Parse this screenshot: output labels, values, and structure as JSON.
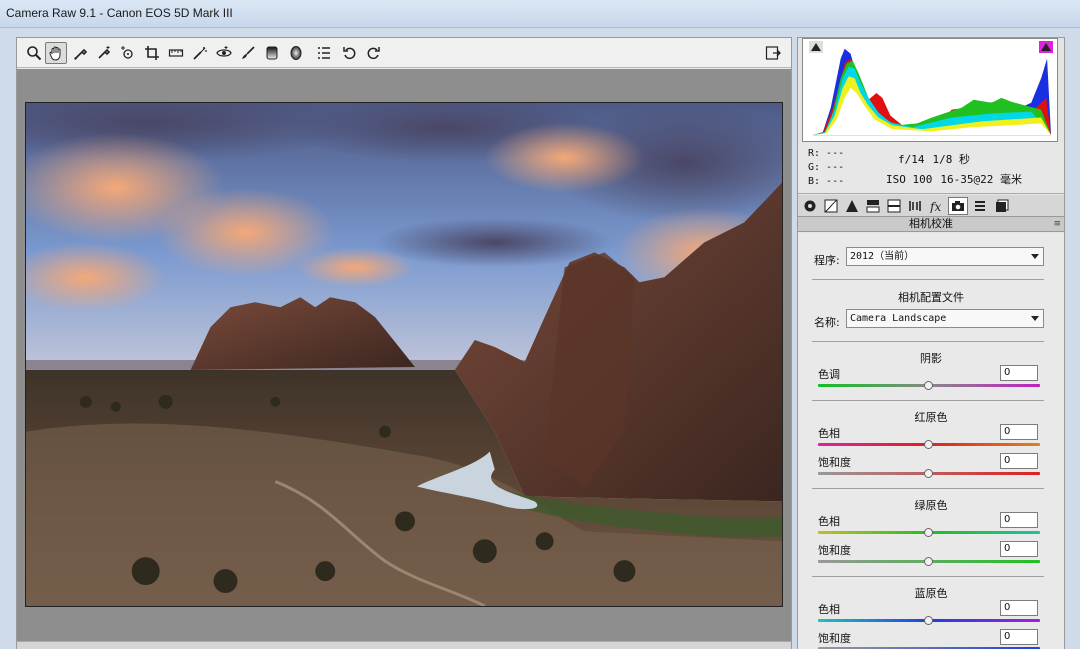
{
  "window": {
    "title": "Camera Raw 9.1  -  Canon EOS 5D Mark III"
  },
  "toolbar": {
    "tools": [
      "zoom-icon",
      "hand-icon",
      "white-balance-icon",
      "color-sampler-icon",
      "targeted-adjustment-icon",
      "crop-icon",
      "straighten-icon",
      "spot-removal-icon",
      "red-eye-icon",
      "adjustment-brush-icon",
      "graduated-filter-icon",
      "radial-filter-icon",
      "preferences-icon",
      "rotate-ccw-icon",
      "rotate-cw-icon"
    ],
    "active_tool": "hand-icon",
    "fullscreen": "toggle-fullscreen-icon"
  },
  "info": {
    "r": "R:  ---",
    "g": "G:  ---",
    "b": "B:  ---",
    "aperture": "f/14",
    "shutter": "1/8 秒",
    "iso": "ISO 100",
    "lens": "16-35@22 毫米"
  },
  "tabs": [
    "basic-icon",
    "tone-curve-icon",
    "detail-icon",
    "hsl-icon",
    "split-toning-icon",
    "lens-corrections-icon",
    "effects-icon",
    "camera-calibration-icon",
    "presets-icon",
    "snapshots-icon"
  ],
  "panel": {
    "title": "相机校准",
    "process_label": "程序:",
    "process_value": "2012（当前）",
    "profile_title": "相机配置文件",
    "name_label": "名称:",
    "name_value": "Camera Landscape",
    "shadows": {
      "title": "阴影",
      "tint_label": "色调",
      "tint_value": "0"
    },
    "red": {
      "title": "红原色",
      "hue_label": "色相",
      "hue_value": "0",
      "sat_label": "饱和度",
      "sat_value": "0"
    },
    "green": {
      "title": "绿原色",
      "hue_label": "色相",
      "hue_value": "0",
      "sat_label": "饱和度",
      "sat_value": "0"
    },
    "blue": {
      "title": "蓝原色",
      "hue_label": "色相",
      "hue_value": "0",
      "sat_label": "饱和度",
      "sat_value": "0"
    }
  },
  "colors": {
    "accent": "#3a6ea5",
    "preview_bg": "#8e8e8e",
    "panel_bg": "#e9e9e9"
  }
}
